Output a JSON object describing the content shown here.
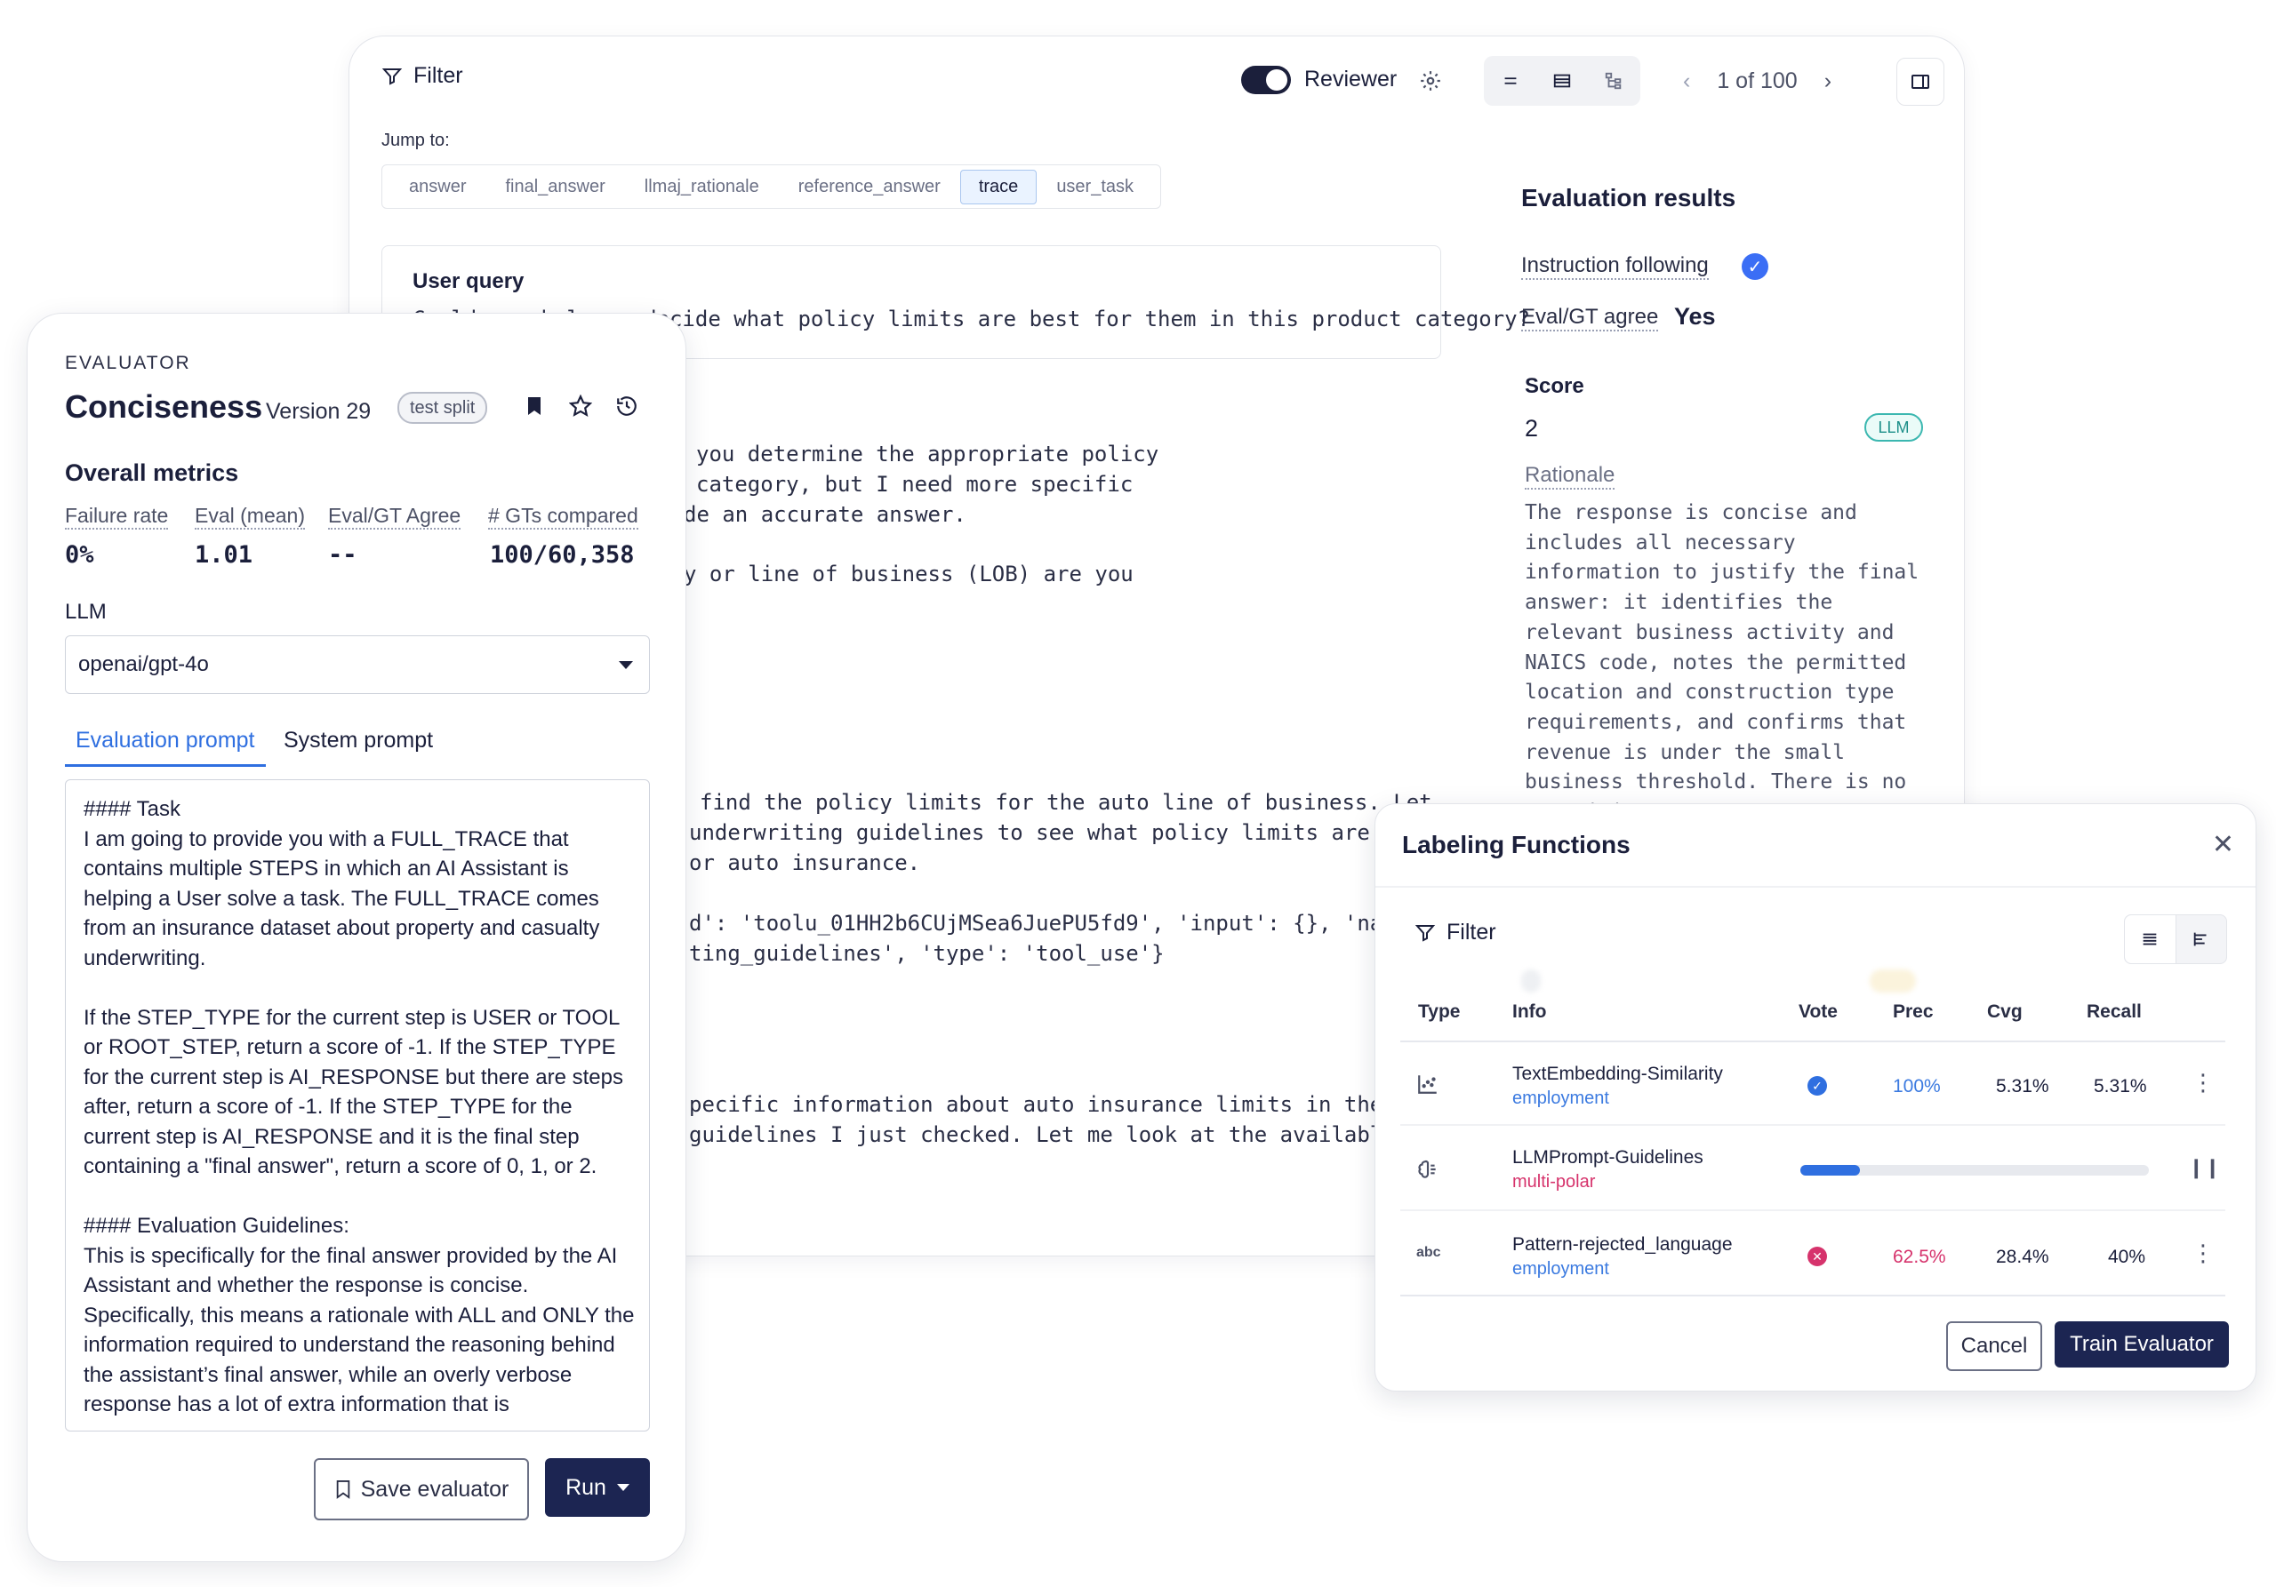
{
  "trace": {
    "filter_label": "Filter",
    "reviewer_label": "Reviewer",
    "pager_text": "1 of 100",
    "jump_label": "Jump to:",
    "jump_tabs": [
      "answer",
      "final_answer",
      "llmaj_rationale",
      "reference_answer",
      "trace",
      "user_task"
    ],
    "active_jump_tab": "trace",
    "user_query_title": "User query",
    "user_query_text": "Could you help me decide what policy limits are best for them in this product category?",
    "lines": [
      "you determine the appropriate policy",
      "category, but I need more specific",
      "de an accurate answer.",
      "y or line of business (LOB) are you",
      "find the policy limits for the auto line of business. Let",
      "underwriting guidelines to see what policy limits are",
      "or auto insurance.",
      "d': 'toolu_01HH2b6CUjMSea6JuePU5fd9', 'input': {}, 'nam",
      "ting_guidelines', 'type': 'tool_use'}",
      "pecific information about auto insurance limits in the",
      "guidelines I just checked. Let me look at the available"
    ]
  },
  "evaluation_results": {
    "title": "Evaluation results",
    "instruction_following_label": "Instruction following",
    "eval_gt_agree_label": "Eval/GT agree",
    "eval_gt_agree_value": "Yes",
    "score_title": "Score",
    "score_value": "2",
    "score_badge": "LLM",
    "rationale_label": "Rationale",
    "rationale_text": "The response is concise and includes all necessary information to justify the final answer: it identifies the relevant business activity and NAICS code, notes the permitted location and construction type requirements, and confirms that revenue is under the small business threshold. There is no repetition or unnecessary information beyond what is"
  },
  "evaluator": {
    "kicker": "EVALUATOR",
    "title": "Conciseness",
    "version": "Version 29",
    "split_badge": "test split",
    "overall_title": "Overall metrics",
    "metrics": [
      {
        "label": "Failure rate",
        "value": "0%"
      },
      {
        "label": "Eval (mean)",
        "value": "1.01"
      },
      {
        "label": "Eval/GT Agree",
        "value": "--"
      },
      {
        "label": "# GTs compared",
        "value": "100/60,358"
      }
    ],
    "llm_label": "LLM",
    "llm_value": "openai/gpt-4o",
    "tabs": [
      "Evaluation prompt",
      "System prompt"
    ],
    "prompt_text": "#### Task\nI am going to provide you with a FULL_TRACE that contains multiple STEPS in which an AI Assistant is helping a User solve a task. The FULL_TRACE comes from an insurance dataset about property and casualty underwriting.\n\nIf the STEP_TYPE for the current step is USER or TOOL or ROOT_STEP, return a score of -1. If the STEP_TYPE for the current step is AI_RESPONSE but there are steps after, return a score of -1. If the STEP_TYPE for the current step is AI_RESPONSE and it is the final step containing a \"final answer\", return a score of 0, 1, or 2.\n\n#### Evaluation Guidelines:\nThis is specifically for the final answer provided by the AI Assistant and whether the response is concise. Specifically, this means a rationale with ALL and ONLY the information required to understand the reasoning behind the assistant’s final answer, while an overly verbose response has a lot of extra information that is",
    "save_label": "Save evaluator",
    "run_label": "Run"
  },
  "labeling_functions": {
    "title": "Labeling Functions",
    "filter_label": "Filter",
    "columns": [
      "Type",
      "Info",
      "Vote",
      "Prec",
      "Cvg",
      "Recall"
    ],
    "rows": [
      {
        "type_icon": "scatter-chart-icon",
        "name": "TextEmbedding-Similarity",
        "tag": "employment",
        "tag_color": "#3b7ae0",
        "vote": "positive",
        "prec": "100%",
        "prec_color": "#3b7ae0",
        "cvg": "5.31%",
        "recall": "5.31%"
      },
      {
        "type_icon": "brain-icon",
        "name": "LLMPrompt-Guidelines",
        "tag": "multi-polar",
        "tag_color": "#d6336c",
        "vote": "running",
        "progress": 0.17
      },
      {
        "type_icon": "abc-icon",
        "name": "Pattern-rejected_language",
        "tag": "employment",
        "tag_color": "#3b7ae0",
        "vote": "negative",
        "prec": "62.5%",
        "prec_color": "#d6336c",
        "cvg": "28.4%",
        "recall": "40%"
      }
    ],
    "cancel_label": "Cancel",
    "train_label": "Train Evaluator"
  }
}
